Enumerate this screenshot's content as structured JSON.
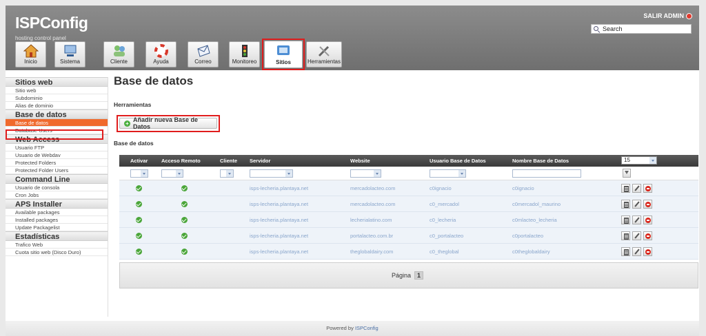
{
  "header": {
    "logo": "ISPConfig",
    "tagline": "hosting control panel",
    "logout": "SALIR ADMIN",
    "search_placeholder": "Search"
  },
  "tabs": [
    {
      "label": "Inicio",
      "icon": "home-icon"
    },
    {
      "label": "Sistema",
      "icon": "system-icon"
    },
    {
      "label": "Cliente",
      "icon": "client-icon"
    },
    {
      "label": "Ayuda",
      "icon": "help-icon"
    },
    {
      "label": "Correo",
      "icon": "mail-icon"
    },
    {
      "label": "Monitoreo",
      "icon": "monitor-icon"
    },
    {
      "label": "Sitios",
      "icon": "sites-icon",
      "active": true
    },
    {
      "label": "Herramientas",
      "icon": "tools-icon"
    }
  ],
  "sidebar": [
    {
      "title": "Sitios web",
      "items": [
        "Sitio web",
        "Subdominio",
        "Alias de dominio"
      ]
    },
    {
      "title": "Base de datos",
      "items": [
        "Base de datos",
        "Database Users"
      ]
    },
    {
      "title": "Web Access",
      "items": [
        "Usuario FTP",
        "Usuario de Webdav",
        "Protected Folders",
        "Protected Folder Users"
      ]
    },
    {
      "title": "Command Line",
      "items": [
        "Usuario de consola",
        "Cron Jobs"
      ]
    },
    {
      "title": "APS Installer",
      "items": [
        "Available packages",
        "Installed packages",
        "Update Packagelist"
      ]
    },
    {
      "title": "Estadísticas",
      "items": [
        "Trafico Web",
        "Cuota sitio web (Disco Duro)"
      ]
    }
  ],
  "main": {
    "title": "Base de datos",
    "tools_label": "Herramientas",
    "add_button": "Añadir nueva Base de Datos",
    "list_label": "Base de datos"
  },
  "table": {
    "columns": [
      "Activar",
      "Acceso Remoto",
      "Cliente",
      "Servidor",
      "Website",
      "Usuario Base de Datos",
      "Nombre Base de Datos"
    ],
    "per_page": "15",
    "rows": [
      [
        "",
        "",
        "",
        "isps-lecheria.plantaya.net",
        "mercadolacteo.com",
        "c0ignacio",
        "c0ignacio"
      ],
      [
        "",
        "",
        "",
        "isps-lecheria.plantaya.net",
        "mercadolacteo.com",
        "c0_mercadol",
        "c0mercadol_maurino"
      ],
      [
        "",
        "",
        "",
        "isps-lecheria.plantaya.net",
        "lecherialatino.com",
        "c0_lecheria",
        "c0mlacteo_lecheria"
      ],
      [
        "",
        "",
        "",
        "isps-lecheria.plantaya.net",
        "portalacteo.com.br",
        "c0_portalacteo",
        "c0portalacteo"
      ],
      [
        "",
        "",
        "",
        "isps-lecheria.plantaya.net",
        "theglobaldairy.com",
        "c0_theglobal",
        "c0theglobaldairy"
      ]
    ],
    "pagination_label": "Página",
    "current_page": "1"
  },
  "footer": {
    "prefix": "Powered by",
    "link": "ISPConfig"
  }
}
